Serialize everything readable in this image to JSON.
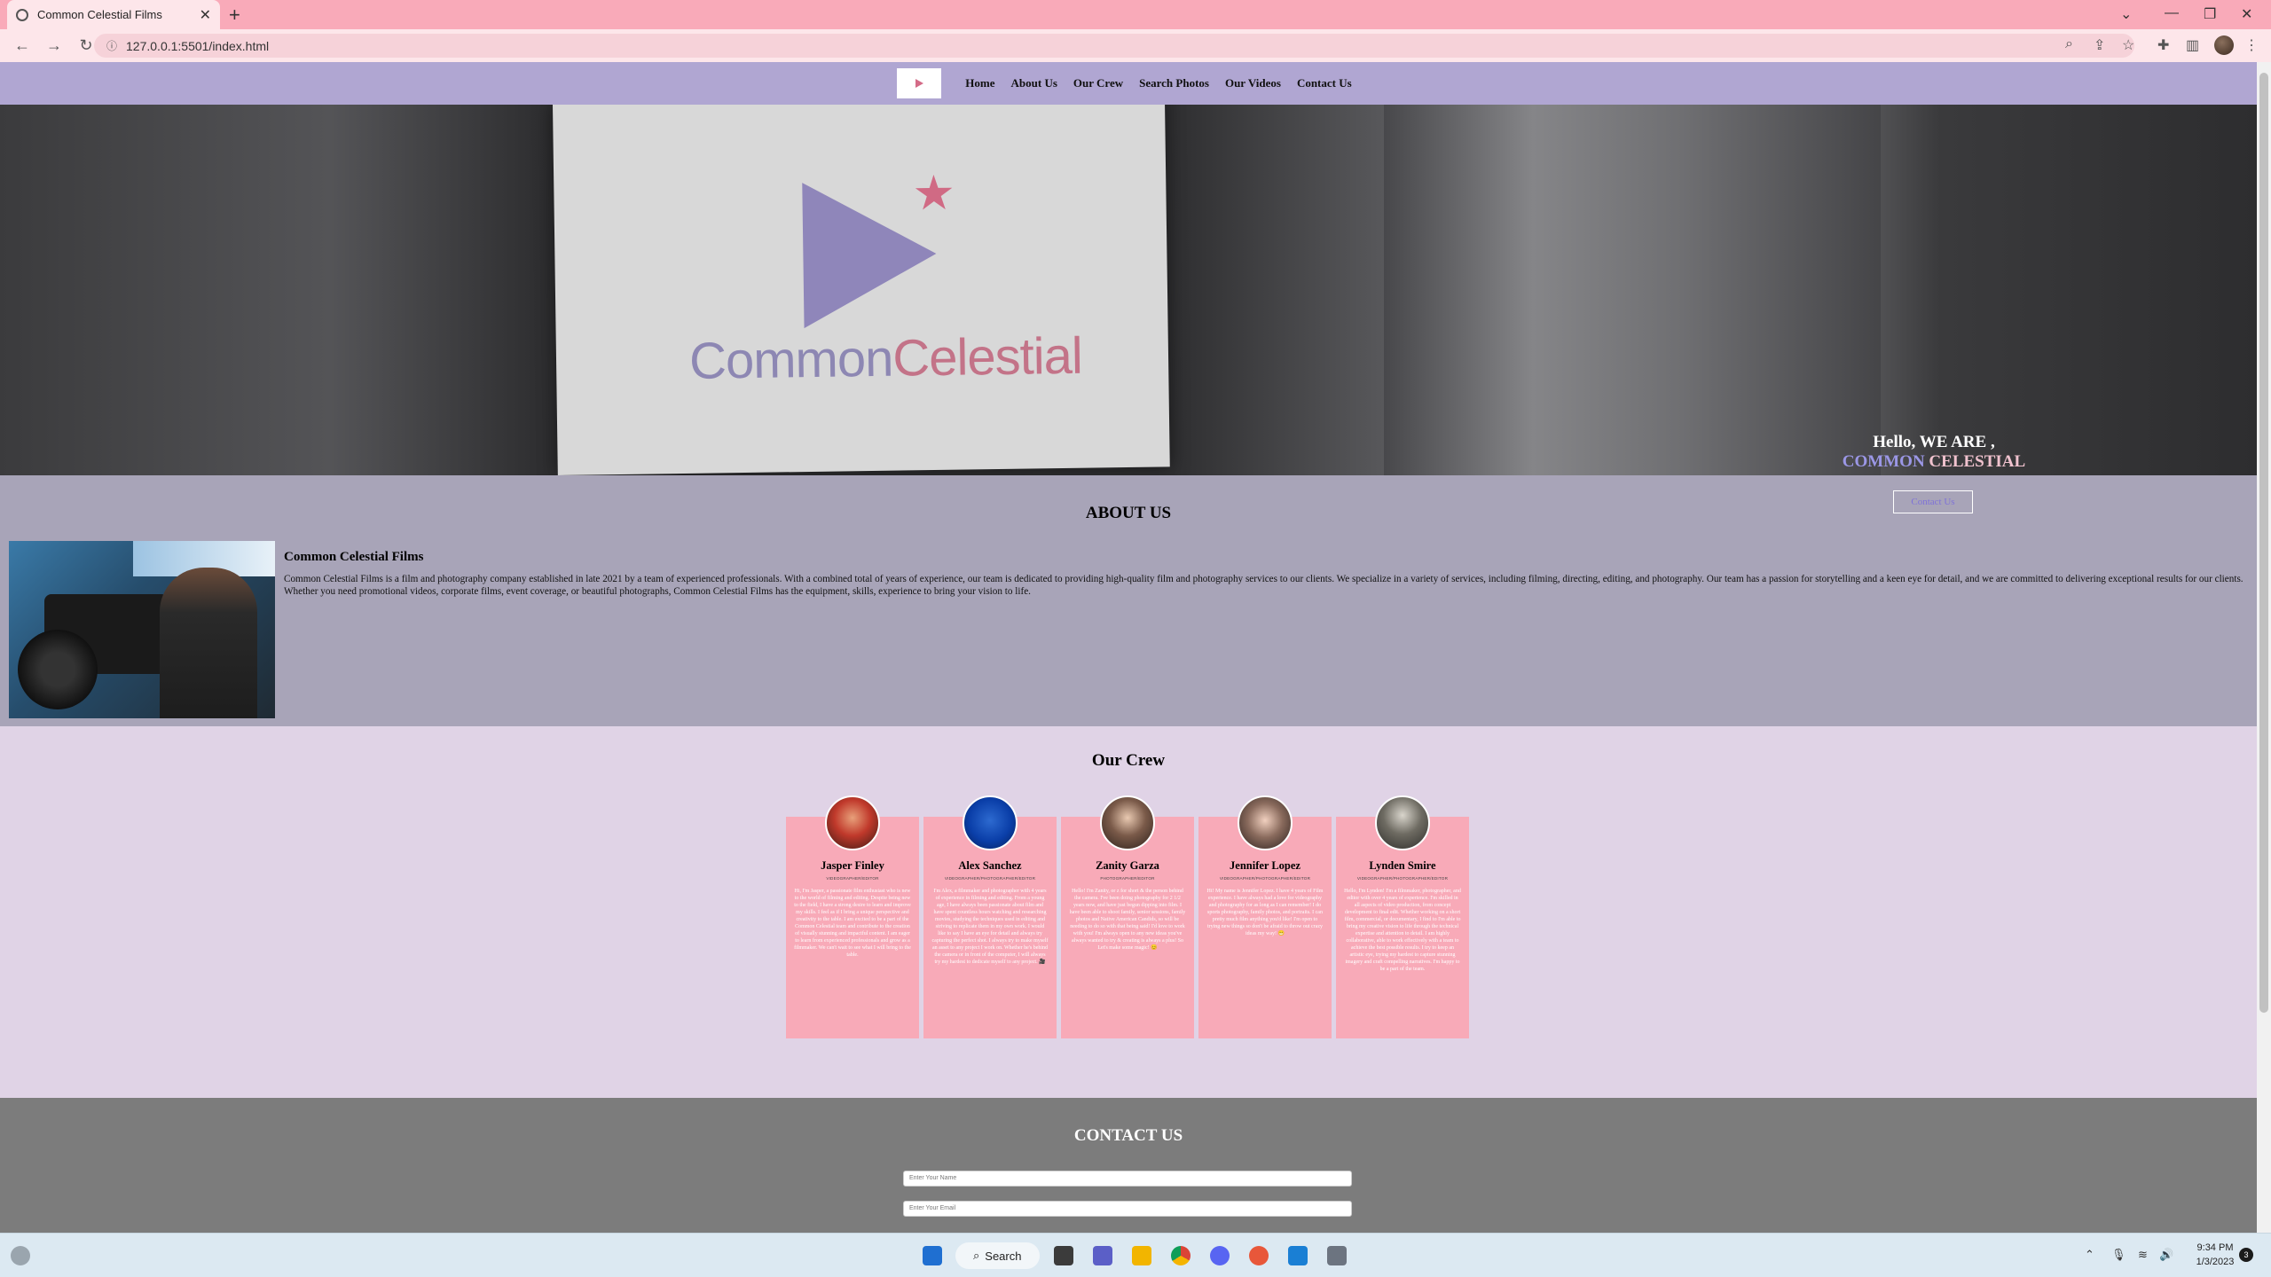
{
  "browser": {
    "tab_title": "Common Celestial Films",
    "tab_close": "✕",
    "new_tab": "+",
    "url": "127.0.0.1:5501/index.html"
  },
  "site_nav": {
    "links": [
      "Home",
      "About Us",
      "Our Crew",
      "Search Photos",
      "Our Videos",
      "Contact Us"
    ]
  },
  "hero": {
    "card_word_1": "Common",
    "card_word_2": "Celestial",
    "hello_line": "Hello, WE ARE ,",
    "name_part_1": "COMMON",
    "name_part_2": "CELESTIAL"
  },
  "about": {
    "title": "ABOUT US",
    "contact_button": "Contact Us",
    "subtitle": "Common Celestial Films",
    "text": "Common Celestial Films is a film and photography company established in late 2021 by a team of experienced professionals. With a combined total of years of experience, our team is dedicated to providing high-quality film and photography services to our clients. We specialize in a variety of services, including filming, directing, editing, and photography. Our team has a passion for storytelling and a keen eye for detail, and we are committed to delivering exceptional results for our clients. Whether you need promotional videos, corporate films, event coverage, or beautiful photographs, Common Celestial Films has the equipment, skills, experience to bring your vision to life."
  },
  "crew": {
    "title": "Our Crew",
    "members": [
      {
        "name": "Jasper Finley",
        "role": "VIDEOGRAPHER/EDITOR",
        "bio": "Hi, I'm Jasper, a passionate film enthusiast who is new to the world of filming and editing. Despite being new to the field, I have a strong desire to learn and improve my skills. I feel as if I bring a unique perspective and creativity to the table. I am excited to be a part of the Common Celestial team and contribute to the creation of visually stunning and impactful content. I am eager to learn from experienced professionals and grow as a filmmaker. We can't wait to see what I will bring to the table."
      },
      {
        "name": "Alex Sanchez",
        "role": "VIDEOGRAPHER/PHOTOGRAPHER/EDITOR",
        "bio": "I'm Alex, a filmmaker and photographer with 4 years of experience in filming and editing. From a young age, I have always been passionate about film and have spent countless hours watching and researching movies, studying the techniques used in editing and striving to replicate them in my own work. I would like to say I have an eye for detail and always try capturing the perfect shot. I always try to make myself an asset to any project I work on. Whether he's behind the camera or in front of the computer, I will always try my hardest to dedicate myself to any project. 🎥"
      },
      {
        "name": "Zanity Garza",
        "role": "PHOTOGRAPHER/EDITOR",
        "bio": "Hello! I'm Zanity, or z for short & the person behind the camera. I've been doing photography for 2 1/2 years now, and have just begun dipping into film. I have been able to shoot family, senior sessions, family photos and Native American Candids, so will be needing to do so with that being said! I'd love to work with you! I'm always open to any new ideas you've always wanted to try & creating is always a plus! So Let's make some magic! 😊"
      },
      {
        "name": "Jennifer Lopez",
        "role": "VIDEOGRAPHER/PHOTOGRAPHER/EDITOR",
        "bio": "Hi! My name is Jennifer Lopez. I have 4 years of Film experience. I have always had a love for videography and photography for as long as I can remember! I do sports photography, family photos, and portraits. I can pretty much film anything you'd like! I'm open to trying new things so don't be afraid to throw out crazy ideas my way! 😁"
      },
      {
        "name": "Lynden Smire",
        "role": "VIDEOGRAPHER/PHOTOGRAPHER/EDITOR",
        "bio": "Hello, I'm Lynden! I'm a filmmaker, photographer, and editor with over 4 years of experience. I'm skilled in all aspects of video production, from concept development to final edit. Whether working on a short film, commercial, or documentary, I find to I'm able to bring my creative vision to life through the technical expertise and attention to detail. I am highly collaborative, able to work effectively with a team to achieve the best possible results. I try to keep an artistic eye, trying my hardest to capture stunning imagery and craft compelling narratives. I'm happy to be a part of the team."
      }
    ]
  },
  "contact": {
    "title": "CONTACT US",
    "name_placeholder": "Enter Your Name",
    "email_placeholder": "Enter Your Email"
  },
  "taskbar": {
    "search_label": "Search",
    "time": "9:34 PM",
    "date": "1/3/2023",
    "notifications": "3"
  }
}
